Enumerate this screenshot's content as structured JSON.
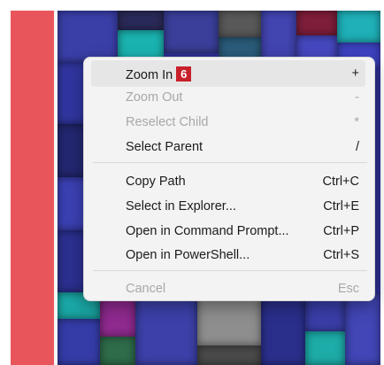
{
  "menu": {
    "items": [
      {
        "label": "Zoom In",
        "shortcut": "+",
        "badge": "6"
      },
      {
        "label": "Zoom Out",
        "shortcut": "-"
      },
      {
        "label": "Reselect Child",
        "shortcut": "*"
      },
      {
        "label": "Select Parent",
        "shortcut": "/"
      },
      {
        "label": "Copy Path",
        "shortcut": "Ctrl+C"
      },
      {
        "label": "Select in Explorer...",
        "shortcut": "Ctrl+E"
      },
      {
        "label": "Open in Command Prompt...",
        "shortcut": "Ctrl+P"
      },
      {
        "label": "Open in PowerShell...",
        "shortcut": "Ctrl+S"
      },
      {
        "label": "Cancel",
        "shortcut": "Esc"
      }
    ]
  },
  "colors": {
    "left_bar": "#e8565b",
    "treemap_base": "#2c2f8f",
    "treemap_teal": "#1ab3b0",
    "treemap_gray": "#8a8a8a",
    "badge": "#c8202a"
  }
}
